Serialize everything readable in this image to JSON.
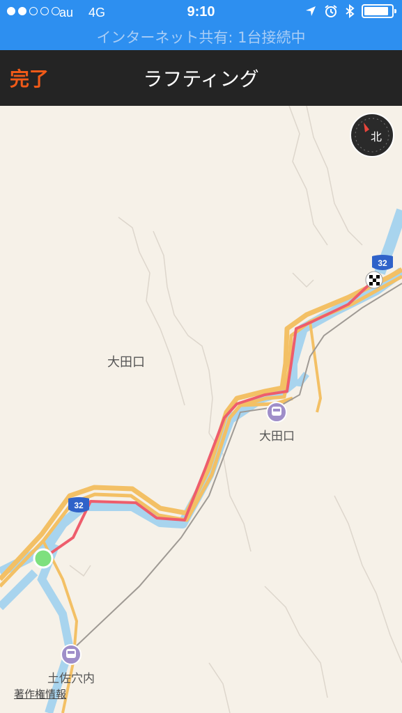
{
  "status_bar": {
    "signal_strength": 2,
    "signal_dots_total": 5,
    "carrier": "au",
    "network": "4G",
    "time": "9:10",
    "battery_level": 0.9,
    "hotspot_banner": "インターネット共有: 1台接続中",
    "icons": [
      "location-arrow-icon",
      "alarm-icon",
      "bluetooth-icon",
      "battery-icon"
    ]
  },
  "nav": {
    "done_label": "完了",
    "title": "ラフティング"
  },
  "map": {
    "compass_label": "北",
    "place_label": "大田口",
    "stations": [
      {
        "name": "大田口"
      },
      {
        "name": "土佐穴内"
      }
    ],
    "route_shields": [
      "32",
      "32"
    ],
    "copyright_label": "著作権情報",
    "colors": {
      "land": "#f6f1e8",
      "river": "#a8d4ee",
      "road": "#f6c85f",
      "route": "#ee5d6c",
      "start": "#7ee07e",
      "station": "#9f8ec9",
      "shield": "#2f62c9"
    }
  }
}
